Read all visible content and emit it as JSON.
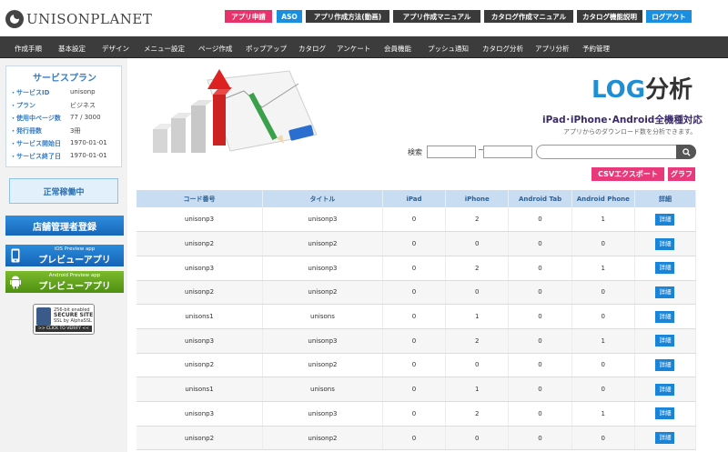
{
  "brand": {
    "name": "UNISONPLANET"
  },
  "top_buttons": [
    {
      "label": "アプリ申請",
      "color": "#e6336b"
    },
    {
      "label": "ASO",
      "color": "#1a8fe0"
    },
    {
      "label": "アプリ作成方法(動画)",
      "color": "#3a3a3a"
    },
    {
      "label": "アプリ作成マニュアル",
      "color": "#3a3a3a"
    },
    {
      "label": "カタログ作成マニュアル",
      "color": "#3a3a3a"
    },
    {
      "label": "カタログ機能説明",
      "color": "#3a3a3a"
    },
    {
      "label": "ログアウト",
      "color": "#1a8fe0"
    }
  ],
  "nav": [
    "作成手順",
    "基本設定",
    "デザイン",
    "メニュー設定",
    "ページ作成",
    "ポップアップ",
    "カタログ",
    "アンケート",
    "会員機能",
    "プッシュ通知",
    "カタログ分析",
    "アプリ分析",
    "予約管理"
  ],
  "plan": {
    "title": "サービスプラン",
    "rows": [
      {
        "label": "・サービスID",
        "value": "unisonp"
      },
      {
        "label": "・プラン",
        "value": "ビジネス"
      },
      {
        "label": "・使用中ページ数",
        "value": "77 / 3000"
      },
      {
        "label": "・発行冊数",
        "value": "3冊"
      },
      {
        "label": "・サービス開始日",
        "value": "1970-01-01"
      },
      {
        "label": "・サービス終了日",
        "value": "1970-01-01"
      }
    ]
  },
  "status": {
    "label": "正常稼働中"
  },
  "store_register": {
    "label": "店舗管理者登録"
  },
  "ios_preview": {
    "small": "iOS Preview app",
    "big": "プレビューアプリ"
  },
  "android_preview": {
    "small": "Android Preview app",
    "big": "プレビューアプリ"
  },
  "ssl": {
    "line1": "256-bit enabled",
    "line2": "SECURE SITE",
    "line3": "SSL by AlphaSSL",
    "click": ">> CLICK TO VERIFY <<"
  },
  "page": {
    "title_accent": "LOG",
    "title_main": "分析",
    "subtitle": "iPad･iPhone･Android全機種対応",
    "description": "アプリからのダウンロード数を分析できます。"
  },
  "search": {
    "label": "検索",
    "tilde": "~",
    "date_from": "",
    "date_to": "",
    "keyword": ""
  },
  "actions": {
    "csv_label": "CSVエクスポート",
    "graph_label": "グラフ"
  },
  "table": {
    "headers": [
      "コード番号",
      "タイトル",
      "iPad",
      "iPhone",
      "Android Tab",
      "Android Phone",
      "詳細"
    ],
    "detail_label": "詳細",
    "rows": [
      [
        "unisonp3",
        "unisonp3",
        "0",
        "2",
        "0",
        "1"
      ],
      [
        "unisonp2",
        "unisonp2",
        "0",
        "0",
        "0",
        "0"
      ],
      [
        "unisonp3",
        "unisonp3",
        "0",
        "2",
        "0",
        "1"
      ],
      [
        "unisonp2",
        "unisonp2",
        "0",
        "0",
        "0",
        "0"
      ],
      [
        "unisons1",
        "unisons",
        "0",
        "1",
        "0",
        "0"
      ],
      [
        "unisonp3",
        "unisonp3",
        "0",
        "2",
        "0",
        "1"
      ],
      [
        "unisonp2",
        "unisonp2",
        "0",
        "0",
        "0",
        "0"
      ],
      [
        "unisons1",
        "unisons",
        "0",
        "1",
        "0",
        "0"
      ],
      [
        "unisonp3",
        "unisonp3",
        "0",
        "2",
        "0",
        "1"
      ],
      [
        "unisonp2",
        "unisonp2",
        "0",
        "0",
        "0",
        "0"
      ]
    ]
  }
}
